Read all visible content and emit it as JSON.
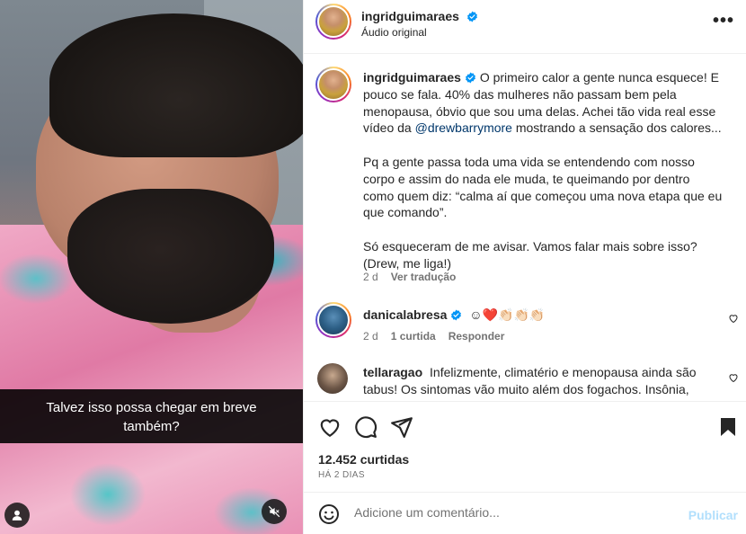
{
  "video": {
    "caption_line1": "Talvez isso possa chegar em breve",
    "caption_line2": "também?",
    "user_icon": "user-icon",
    "mute_icon": "speaker-muted-icon"
  },
  "header": {
    "username": "ingridguimaraes",
    "audio": "Áudio original",
    "more": "•••"
  },
  "post": {
    "username": "ingridguimaraes",
    "p1_a": "O primeiro calor a gente nunca esquece! E pouco se fala. 40% das mulheres não passam bem pela menopausa, óbvio que sou uma delas. Achei tão vida real esse vídeo da ",
    "mention": "@drewbarrymore",
    "p1_b": " mostrando a sensação dos calores...",
    "p2": "Pq a gente passa toda uma vida se entendendo com nosso corpo e assim do nada ele muda, te queimando por dentro como quem diz: “calma aí que começou uma nova etapa que eu que comando”.",
    "p3": "Só esqueceram de me avisar. Vamos falar mais sobre isso? (Drew, me liga!)",
    "time": "2 d",
    "translate": "Ver tradução"
  },
  "comments": [
    {
      "username": "danicalabresa",
      "text": "☺❤️👏🏻👏🏻👏🏻",
      "time": "2 d",
      "likes": "1 curtida",
      "reply": "Responder"
    },
    {
      "username": "tellaragao",
      "text": "Infelizmente, climatério e menopausa ainda são tabus! Os sintomas vão muito além dos fogachos. Insônia,"
    }
  ],
  "actions": {
    "likes": "12.452 curtidas",
    "date": "HÁ 2 DIAS"
  },
  "composer": {
    "placeholder": "Adicione um comentário...",
    "post": "Publicar"
  },
  "colors": {
    "accent": "#0095f6",
    "post_disabled": "#b2dffc",
    "verified": "#0095f6",
    "like_red": "#ed4956"
  }
}
